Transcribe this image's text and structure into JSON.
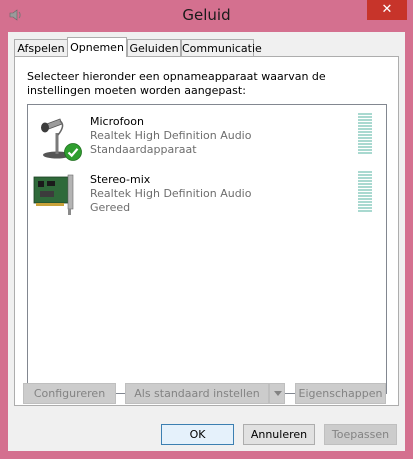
{
  "window": {
    "title": "Geluid",
    "close_label": "✕"
  },
  "tabs": [
    {
      "label": "Afspelen",
      "active": false
    },
    {
      "label": "Opnemen",
      "active": true
    },
    {
      "label": "Geluiden",
      "active": false
    },
    {
      "label": "Communicatie",
      "active": false
    }
  ],
  "instruction": "Selecteer hieronder een opnameapparaat waarvan de instellingen moeten worden aangepast:",
  "devices": [
    {
      "name": "Microfoon",
      "driver": "Realtek High Definition Audio",
      "status": "Standaardapparaat",
      "icon": "microphone-icon",
      "default_badge": "check-badge-icon",
      "level": 0
    },
    {
      "name": "Stereo-mix",
      "driver": "Realtek High Definition Audio",
      "status": "Gereed",
      "icon": "sound-card-icon",
      "level": 0
    }
  ],
  "panel_buttons": {
    "configure": "Configureren",
    "set_default": "Als standaard instellen",
    "properties": "Eigenschappen"
  },
  "dialog_buttons": {
    "ok": "OK",
    "cancel": "Annuleren",
    "apply": "Toepassen"
  },
  "colors": {
    "window_frame": "#d4708f",
    "close_button": "#c7342a",
    "meter": "#a9d9d0",
    "check_badge": "#2f9e2f"
  }
}
